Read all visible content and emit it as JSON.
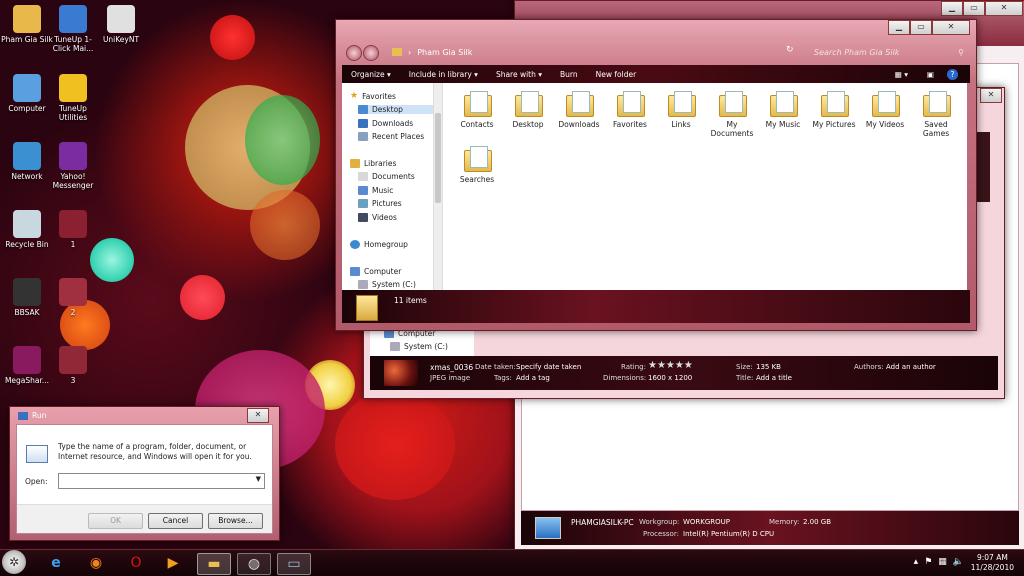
{
  "desktop_icons": [
    {
      "label": "Pham Gia Silk",
      "icon": "folder-icon",
      "color": "#e8b84a"
    },
    {
      "label": "TuneUp 1-Click Mai...",
      "icon": "tuneup-icon",
      "color": "#3a7ad0"
    },
    {
      "label": "UniKeyNT",
      "icon": "unikey-icon",
      "color": "#e0e0e0"
    },
    {
      "label": "Computer",
      "icon": "computer-icon",
      "color": "#5aa0e0"
    },
    {
      "label": "TuneUp Utilities",
      "icon": "tuneup-utilities-icon",
      "color": "#f0c020"
    },
    {
      "label": "Network",
      "icon": "network-icon",
      "color": "#3a90d0"
    },
    {
      "label": "Yahoo! Messenger",
      "icon": "yahoo-messenger-icon",
      "color": "#7b2ca0"
    },
    {
      "label": "Recycle Bin",
      "icon": "recycle-bin-icon",
      "color": "#c8d8e0"
    },
    {
      "label": "1",
      "icon": "image-thumb-icon",
      "color": "#8a2030"
    },
    {
      "label": "BBSAK",
      "icon": "bbsak-icon",
      "color": "#333333"
    },
    {
      "label": "2",
      "icon": "image-thumb-icon",
      "color": "#a03040"
    },
    {
      "label": "MegaShar...",
      "icon": "megashare-icon",
      "color": "#8a1a60"
    },
    {
      "label": "3",
      "icon": "image-thumb-icon",
      "color": "#902838"
    }
  ],
  "explorer": {
    "address": "Pham Gia Silk",
    "search_placeholder": "Search Pham Gia Silk",
    "toolbar": [
      "Organize ▾",
      "Include in library ▾",
      "Share with ▾",
      "Burn",
      "New folder"
    ],
    "nav": {
      "favorites": "Favorites",
      "desktop": "Desktop",
      "downloads": "Downloads",
      "recent": "Recent Places",
      "libraries": "Libraries",
      "documents": "Documents",
      "music": "Music",
      "pictures": "Pictures",
      "videos": "Videos",
      "homegroup": "Homegroup",
      "computer": "Computer",
      "system": "System (C:)"
    },
    "folders": [
      "Contacts",
      "Desktop",
      "Downloads",
      "Favorites",
      "Links",
      "My Documents",
      "My Music",
      "My Pictures",
      "My Videos",
      "Saved Games",
      "Searches"
    ],
    "status": "11 items"
  },
  "photo_window": {
    "nav_computer": "Computer",
    "nav_system": "System (C:)",
    "filename": "xmas_0036",
    "filetype": "JPEG image",
    "date_label": "Date taken:",
    "date_value": "Specify date taken",
    "tags_label": "Tags:",
    "tags_value": "Add a tag",
    "rating_label": "Rating:",
    "rating_stars": "★★★★★",
    "dim_label": "Dimensions:",
    "dim_value": "1600 x 1200",
    "size_label": "Size:",
    "size_value": "135 KB",
    "title_label": "Title:",
    "title_value": "Add a title",
    "authors_label": "Authors:",
    "authors_value": "Add an author"
  },
  "computer_window": {
    "name": "PHAMGIASILK-PC",
    "workgroup_label": "Workgroup:",
    "workgroup_value": "WORKGROUP",
    "memory_label": "Memory:",
    "memory_value": "2.00 GB",
    "processor_label": "Processor:",
    "processor_value": "Intel(R) Pentium(R) D CPU"
  },
  "run_dialog": {
    "title": "Run",
    "description": "Type the name of a program, folder, document, or Internet resource, and Windows will open it for you.",
    "open_label": "Open:",
    "open_value": "",
    "ok": "OK",
    "cancel": "Cancel",
    "browse": "Browse..."
  },
  "taskbar": {
    "time": "9:07 AM",
    "date": "11/28/2010"
  }
}
